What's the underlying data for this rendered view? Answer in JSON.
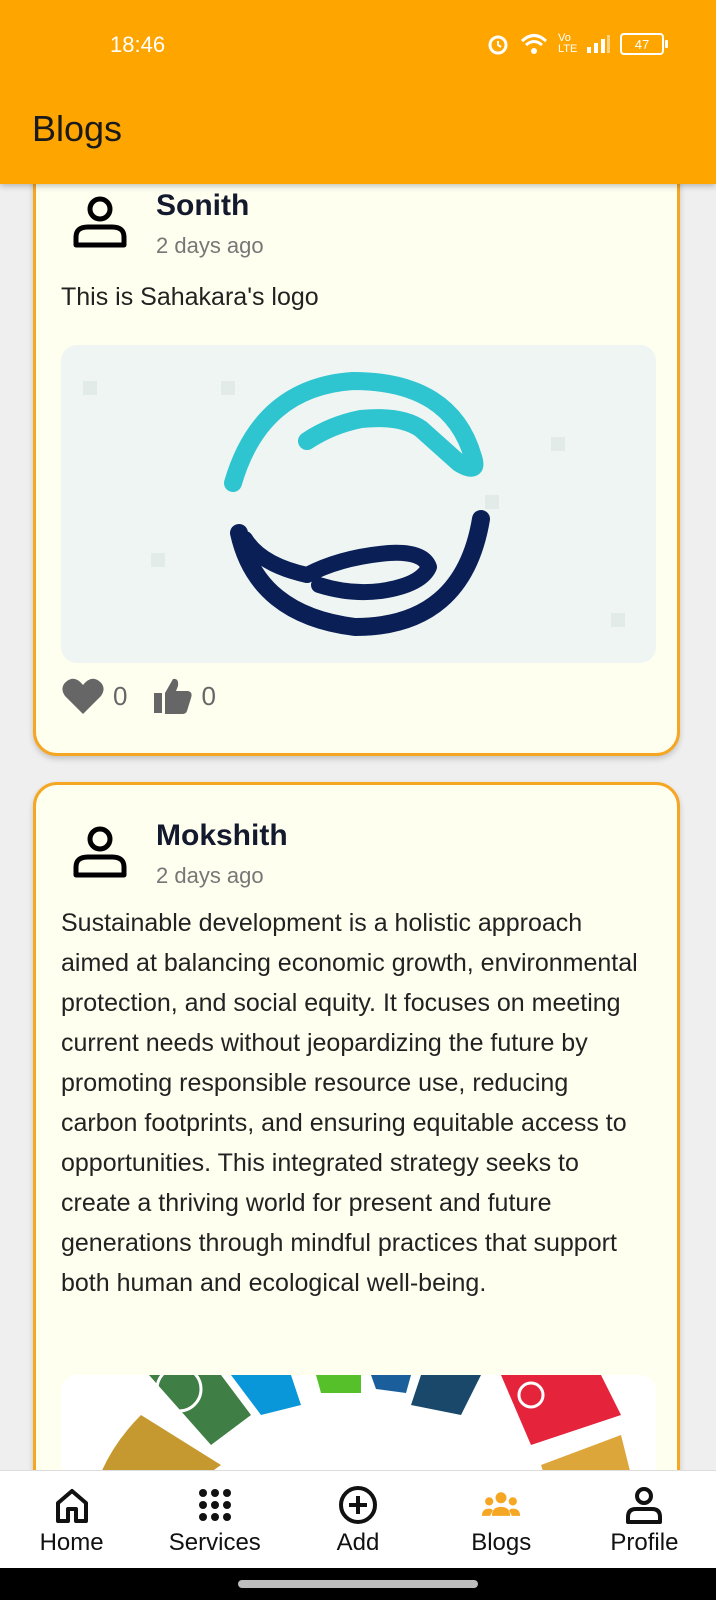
{
  "status_bar": {
    "time": "18:46",
    "battery": "47",
    "network": "Vo LTE"
  },
  "header": {
    "title": "Blogs"
  },
  "posts": [
    {
      "author": "Sonith",
      "time": "2 days ago",
      "text": "This is Sahakara's logo",
      "image": "sahakara-logo",
      "likes": "0",
      "thumbs": "0"
    },
    {
      "author": "Mokshith",
      "time": "2 days ago",
      "text": "Sustainable development is a holistic approach aimed at balancing economic growth, environmental protection, and social equity. It focuses on meeting current needs without jeopardizing the future by promoting responsible resource use, reducing carbon footprints, and ensuring equitable access to opportunities. This integrated strategy seeks to create a thriving world for present and future generations through mindful practices that support both human and ecological well-being.",
      "image": "sdg-wheel"
    }
  ],
  "nav": {
    "items": [
      {
        "label": "Home",
        "icon": "home-icon"
      },
      {
        "label": "Services",
        "icon": "grid-dots-icon"
      },
      {
        "label": "Add",
        "icon": "add-circle-icon"
      },
      {
        "label": "Blogs",
        "icon": "group-icon"
      },
      {
        "label": "Profile",
        "icon": "person-icon"
      }
    ],
    "active": "Blogs"
  },
  "colors": {
    "accent": "#FFA500",
    "card_border": "#F5A623",
    "card_bg": "#FFFFF0",
    "logo_cyan": "#2EC4D0",
    "logo_navy": "#0B1F57"
  }
}
